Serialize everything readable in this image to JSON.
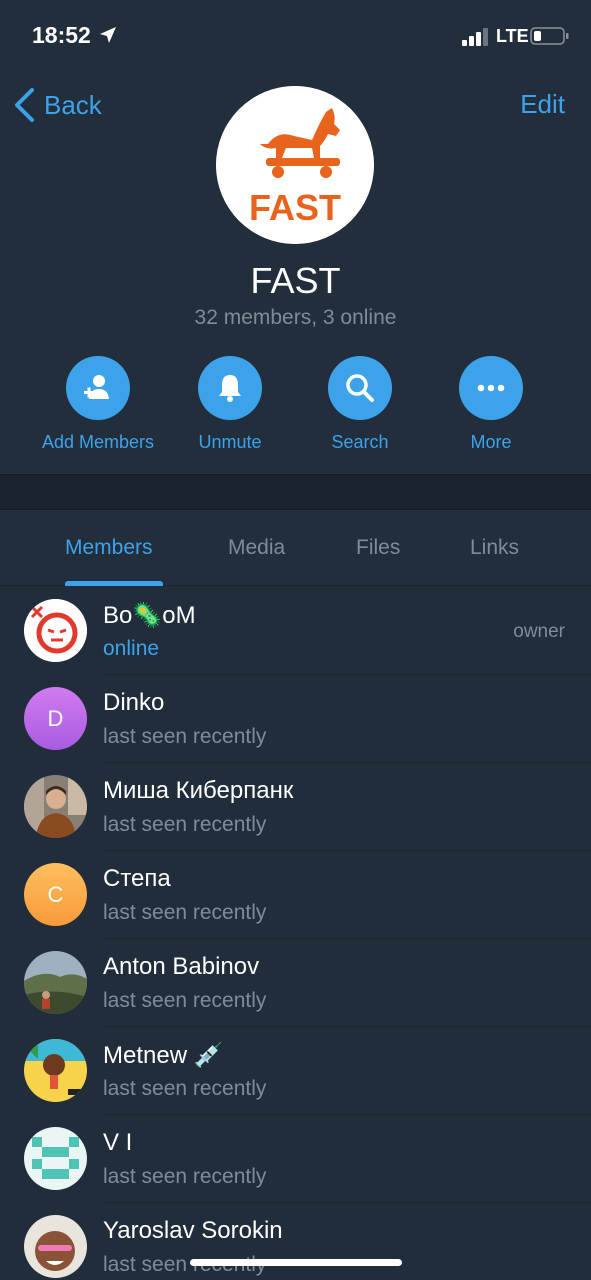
{
  "status_bar": {
    "time": "18:52",
    "network": "LTE"
  },
  "nav": {
    "back_label": "Back",
    "edit_label": "Edit"
  },
  "group": {
    "logo_text": "FAST",
    "title": "FAST",
    "subtitle": "32 members, 3 online"
  },
  "actions": [
    {
      "label": "Add Members",
      "icon": "add-member-icon"
    },
    {
      "label": "Unmute",
      "icon": "bell-icon"
    },
    {
      "label": "Search",
      "icon": "search-icon"
    },
    {
      "label": "More",
      "icon": "more-icon"
    }
  ],
  "tabs": [
    {
      "label": "Members",
      "active": true
    },
    {
      "label": "Media",
      "active": false
    },
    {
      "label": "Files",
      "active": false
    },
    {
      "label": "Links",
      "active": false
    }
  ],
  "members": [
    {
      "name": "Bo🦠oM",
      "status": "online",
      "role": "owner",
      "avatar": "image",
      "online": true
    },
    {
      "name": "Dinko",
      "status": "last seen recently",
      "role": "",
      "avatar_letter": "D",
      "avatar_color": "#b86ee8"
    },
    {
      "name": "Миша Киберпанк",
      "status": "last seen recently",
      "role": "",
      "avatar": "image"
    },
    {
      "name": "Степа",
      "status": "last seen recently",
      "role": "",
      "avatar_letter": "C",
      "avatar_color": "#f9a84a"
    },
    {
      "name": "Anton Babinov",
      "status": "last seen recently",
      "role": "",
      "avatar": "image"
    },
    {
      "name": "Metnew 💉",
      "status": "last seen recently",
      "role": "",
      "avatar": "image"
    },
    {
      "name": "V I",
      "status": "last seen recently",
      "role": "",
      "avatar": "image"
    },
    {
      "name": "Yaroslav Sorokin",
      "status": "last seen recently",
      "role": "",
      "avatar": "image"
    }
  ],
  "colors": {
    "accent": "#3ca3eb",
    "background": "#212d3b",
    "logo_orange": "#e8631c"
  }
}
